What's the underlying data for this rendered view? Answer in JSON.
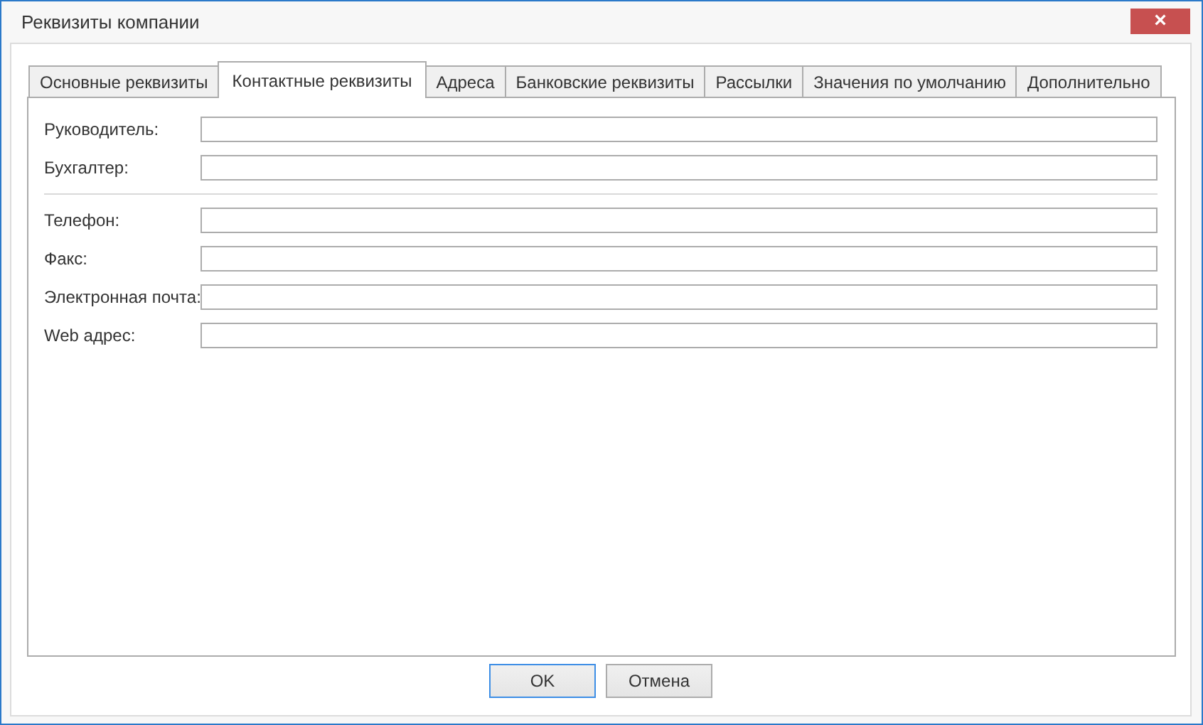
{
  "window": {
    "title": "Реквизиты компании",
    "close": "×"
  },
  "tabs": [
    {
      "label": "Основные реквизиты",
      "selected": false
    },
    {
      "label": "Контактные реквизиты",
      "selected": true
    },
    {
      "label": "Адреса",
      "selected": false
    },
    {
      "label": "Банковские реквизиты",
      "selected": false
    },
    {
      "label": "Рассылки",
      "selected": false
    },
    {
      "label": "Значения по умолчанию",
      "selected": false
    },
    {
      "label": "Дополнительно",
      "selected": false
    }
  ],
  "field_groups": [
    [
      {
        "label": "Руководитель:"
      },
      {
        "label": "Бухгалтер:"
      }
    ],
    [
      {
        "label": "Телефон:"
      },
      {
        "label": "Факс:"
      },
      {
        "label": "Электронная почта:"
      },
      {
        "label": "Web адрес:"
      }
    ]
  ],
  "buttons": [
    {
      "label": "OK",
      "focused": true
    },
    {
      "label": "Отмена",
      "focused": false
    }
  ]
}
